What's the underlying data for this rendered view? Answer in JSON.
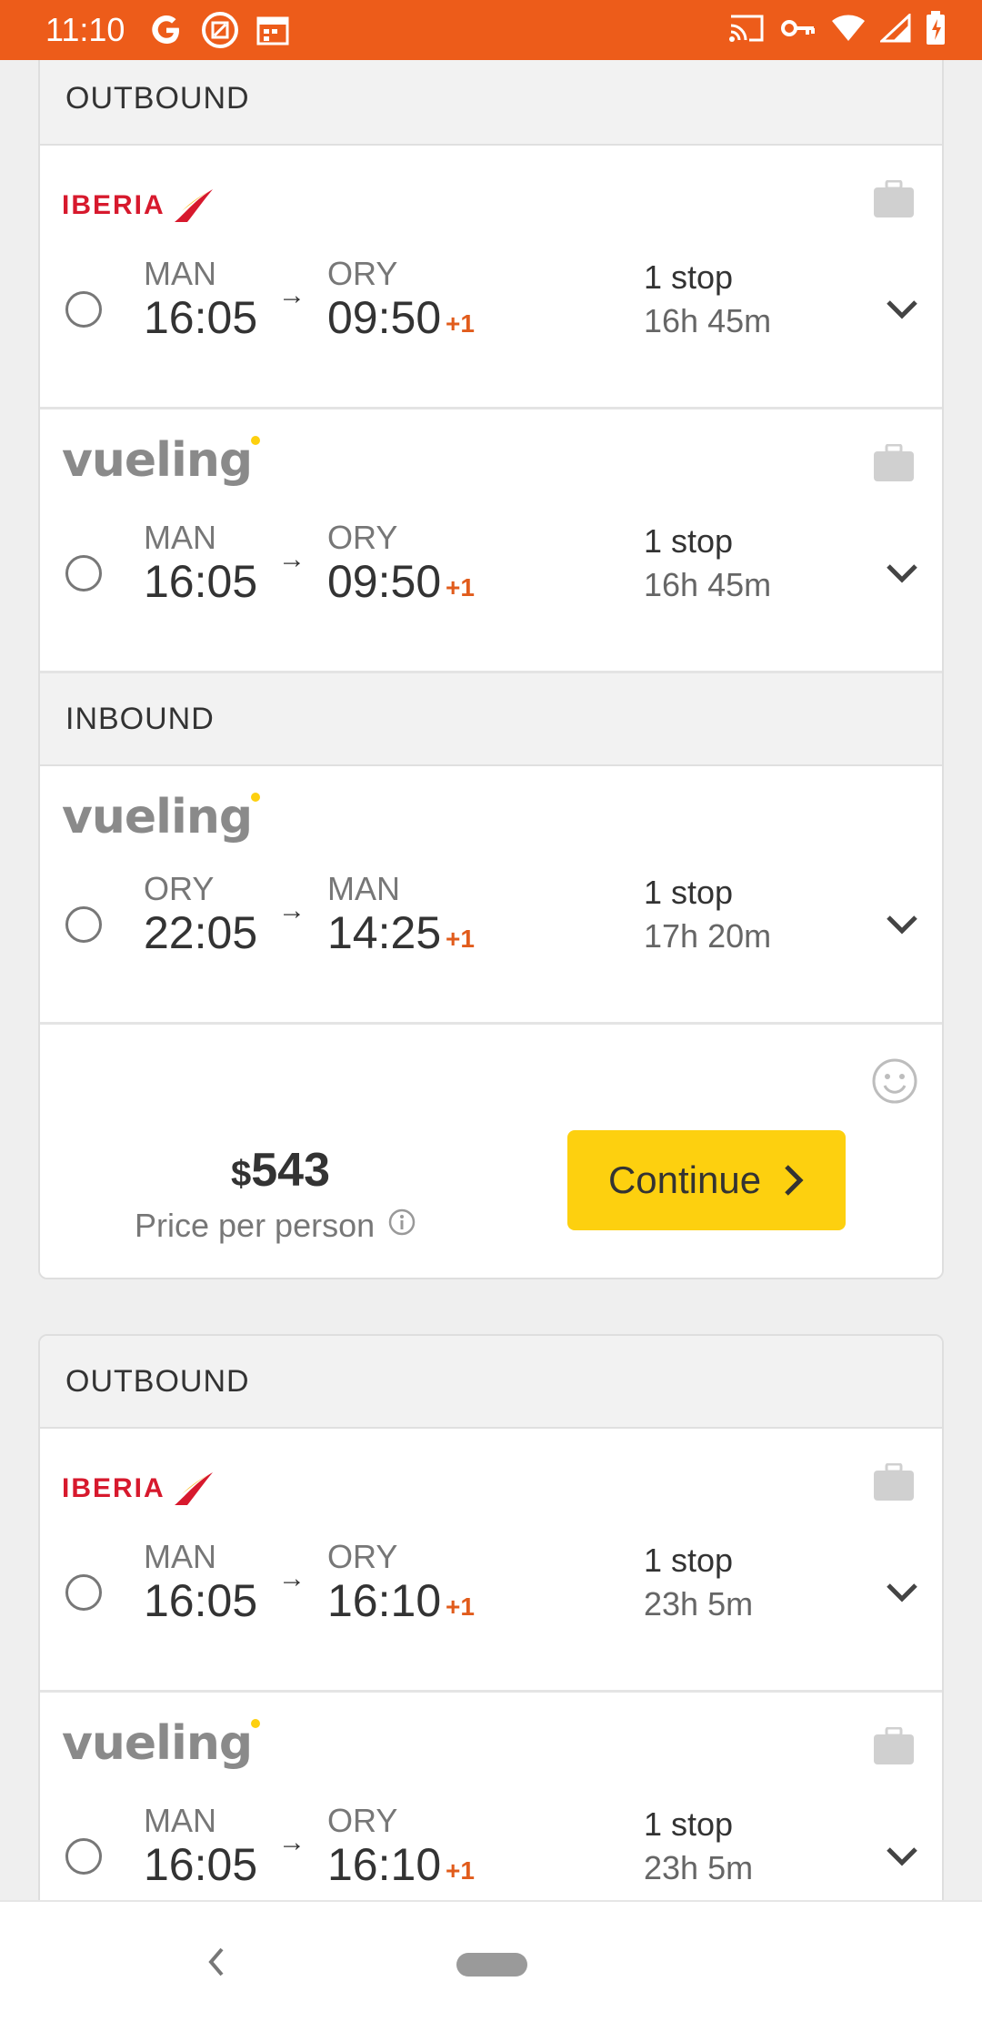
{
  "status_bar": {
    "time": "11:10",
    "left_icons": [
      "google-icon",
      "app-icon",
      "calendar-icon"
    ],
    "right_icons": [
      "cast-icon",
      "key-icon",
      "wifi-icon",
      "signal-icon",
      "battery-icon"
    ],
    "color": "#ed5c1a"
  },
  "cards": [
    {
      "outbound_header": "OUTBOUND",
      "outbound_flights": [
        {
          "airline": "IBERIA",
          "from_code": "MAN",
          "to_code": "ORY",
          "depart": "16:05",
          "arrive": "09:50",
          "day_offset": "+1",
          "stops": "1 stop",
          "duration": "16h 45m"
        },
        {
          "airline": "vueling",
          "from_code": "MAN",
          "to_code": "ORY",
          "depart": "16:05",
          "arrive": "09:50",
          "day_offset": "+1",
          "stops": "1 stop",
          "duration": "16h 45m"
        }
      ],
      "inbound_header": "INBOUND",
      "inbound_flights": [
        {
          "airline": "vueling",
          "from_code": "ORY",
          "to_code": "MAN",
          "depart": "22:05",
          "arrive": "14:25",
          "day_offset": "+1",
          "stops": "1 stop",
          "duration": "17h 20m"
        }
      ],
      "price_currency": "$",
      "price_amount": "543",
      "price_label": "Price per person",
      "continue_label": "Continue"
    },
    {
      "outbound_header": "OUTBOUND",
      "outbound_flights": [
        {
          "airline": "IBERIA",
          "from_code": "MAN",
          "to_code": "ORY",
          "depart": "16:05",
          "arrive": "16:10",
          "day_offset": "+1",
          "stops": "1 stop",
          "duration": "23h 5m"
        },
        {
          "airline": "vueling",
          "from_code": "MAN",
          "to_code": "ORY",
          "depart": "16:05",
          "arrive": "16:10",
          "day_offset": "+1",
          "stops": "1 stop",
          "duration": "23h 5m"
        }
      ]
    }
  ],
  "colors": {
    "accent": "#ed5c1a",
    "continue_button": "#fdd00f",
    "day_offset": "#e15c1c",
    "iberia_red": "#d7192d",
    "vueling_yellow": "#fdd00f"
  }
}
